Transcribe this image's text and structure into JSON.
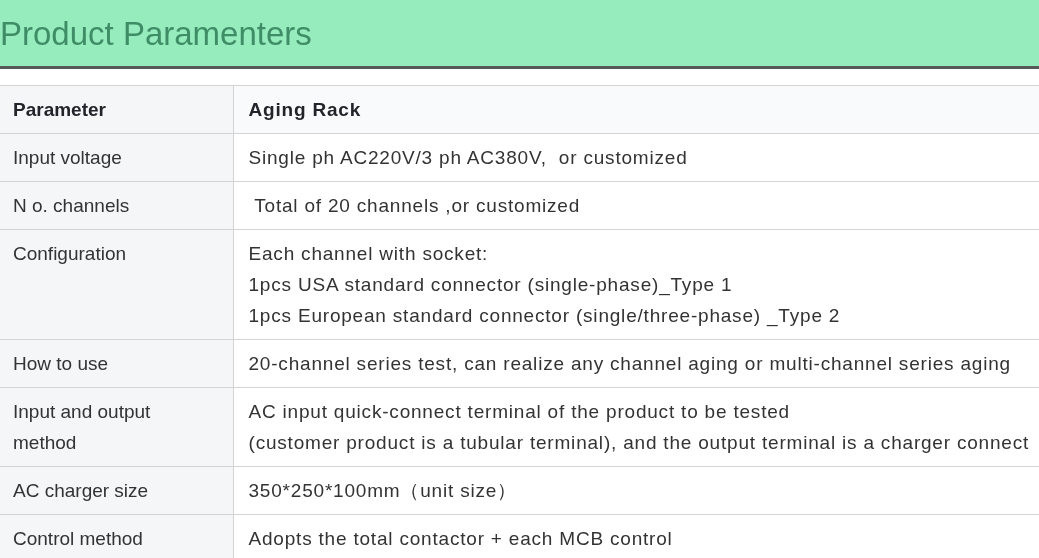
{
  "title": "Product Paramenters",
  "table": {
    "columns": [
      "Parameter",
      "Aging Rack"
    ],
    "rows": [
      {
        "parameter": "Input voltage",
        "value": [
          "Single ph AC220V/3 ph AC380V,  or customized"
        ]
      },
      {
        "parameter": "N o. channels",
        "value": [
          " Total of 20 channels ,or customized"
        ]
      },
      {
        "parameter": "Configuration",
        "value": [
          "Each channel with socket:",
          "1pcs USA standard connector (single-phase)_Type 1",
          "1pcs European standard connector (single/three-phase) _Type 2"
        ]
      },
      {
        "parameter": "How to use",
        "value": [
          "20-channel series test, can realize any channel aging or multi-channel series aging"
        ]
      },
      {
        "parameter": "Input and output method",
        "value": [
          "AC input quick-connect terminal of the product to be tested",
          "(customer product is a tubular terminal), and the output terminal is a charger connect"
        ]
      },
      {
        "parameter": "AC charger size",
        "value": [
          "350*250*100mm（unit size）"
        ]
      },
      {
        "parameter": "Control method",
        "value": [
          "Adopts the total contactor + each MCB control"
        ]
      }
    ]
  }
}
